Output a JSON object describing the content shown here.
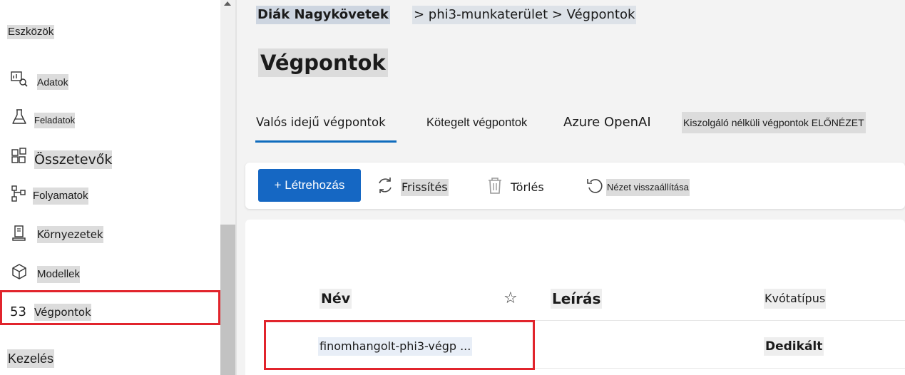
{
  "sidebar": {
    "section_tools": "Eszközök",
    "items": [
      {
        "label": "Adatok",
        "icon": "data-icon"
      },
      {
        "label": "Feladatok",
        "icon": "flask-icon"
      },
      {
        "label": "Összetevők",
        "icon": "components-icon"
      },
      {
        "label": "Folyamatok",
        "icon": "pipeline-icon"
      },
      {
        "label": "Környezetek",
        "icon": "environment-icon"
      },
      {
        "label": "Modellek",
        "icon": "cube-icon"
      },
      {
        "label": "Végpontok",
        "icon": "endpoints-icon",
        "icon_text": "53",
        "selected": true
      }
    ],
    "section_manage": "Kezelés"
  },
  "breadcrumb": {
    "root": "Diák Nagykövetek",
    "path": "> phi3-munkaterület > Végpontok"
  },
  "page_title": "Végpontok",
  "tabs": [
    {
      "label": "Valós idejű végpontok",
      "active": true
    },
    {
      "label": "Kötegelt végpontok"
    },
    {
      "label": "Azure OpenAI"
    },
    {
      "label": "Kiszolgáló nélküli végpontok ELŐNÉZET"
    }
  ],
  "toolbar": {
    "create": "+ Létrehozás",
    "refresh": "Frissítés",
    "delete": "Törlés",
    "reset_view": "Nézet visszaállítása"
  },
  "table": {
    "columns": {
      "name": "Név",
      "star": "☆",
      "description": "Leírás",
      "quota_type": "Kvótatípus"
    },
    "rows": [
      {
        "name": "finomhangolt-phi3-végp ...",
        "description": "",
        "quota_type": "Dedikált"
      }
    ]
  },
  "colors": {
    "accent": "#0f6cbd",
    "button": "#1567c3",
    "highlight_box": "#e1242c"
  }
}
